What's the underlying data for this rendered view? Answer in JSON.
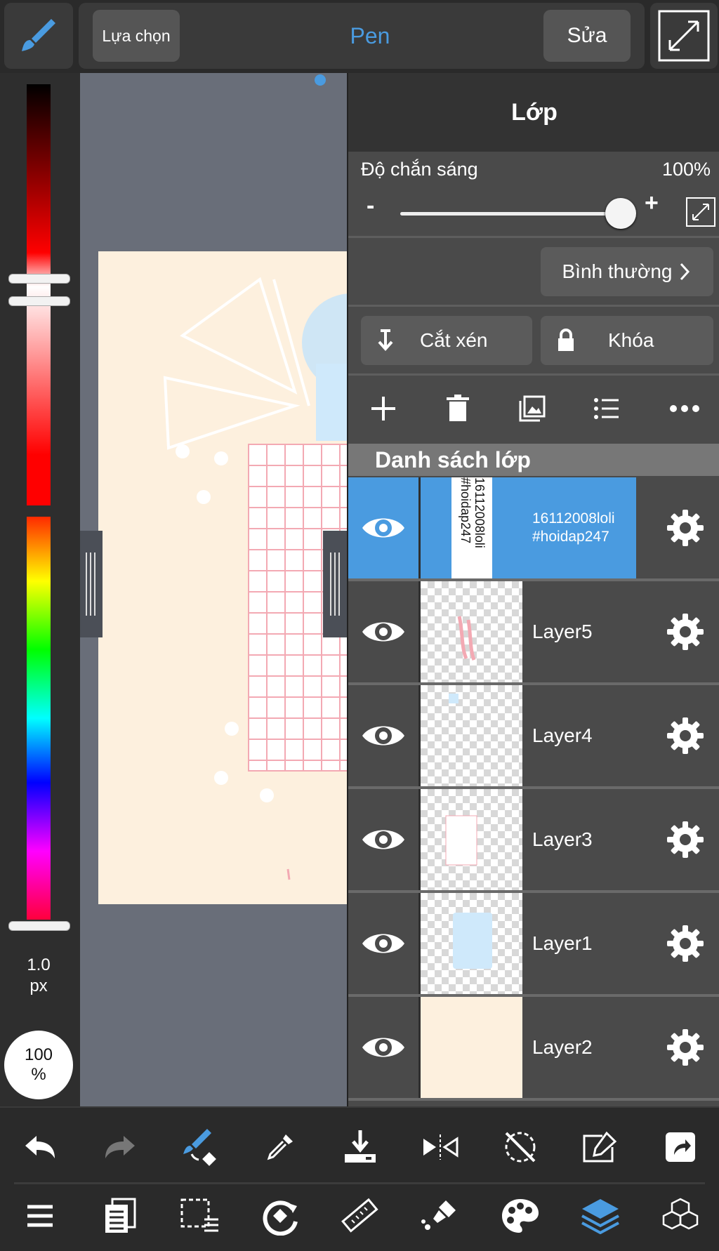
{
  "topbar": {
    "select_label": "Lựa chọn",
    "tool_name": "Pen",
    "edit_label": "Sửa",
    "accent": "#4a9be0"
  },
  "left_panel": {
    "brush_size": "1.0",
    "brush_unit": "px",
    "opacity": "100",
    "opacity_unit": "%"
  },
  "layer_panel": {
    "title": "Lớp",
    "opacity_label": "Độ chắn sáng",
    "opacity_value": "100%",
    "opacity_fraction": 0.95,
    "minus": "-",
    "plus": "+",
    "blend_mode": "Bình thường",
    "clip_label": "Cắt xén",
    "lock_label": "Khóa",
    "list_title": "Danh sách lớp",
    "layers": [
      {
        "name": "16112008loli\n#hoidap247",
        "thumb_text": "16112008loli\n#hoidap247",
        "selected": true
      },
      {
        "name": "Layer5",
        "selected": false
      },
      {
        "name": "Layer4",
        "selected": false
      },
      {
        "name": "Layer3",
        "selected": false
      },
      {
        "name": "Layer1",
        "selected": false
      },
      {
        "name": "Layer2",
        "selected": false
      }
    ]
  },
  "colors": {
    "selected_row": "#4a9be0",
    "canvas_bg": "#fdf0de",
    "grid_pink": "#f3a9b3"
  },
  "bottom_toolbar": {
    "row1": [
      "undo-icon",
      "redo-icon",
      "brush-transform-icon",
      "eyedropper-icon",
      "download-icon",
      "flip-icon",
      "rotate-off-icon",
      "edit-window-icon",
      "share-icon"
    ],
    "row2": [
      "menu-icon",
      "pages-icon",
      "selection-icon",
      "rotate-icon",
      "ruler-icon",
      "fill-icon",
      "palette-icon",
      "layers-icon",
      "3d-icon"
    ]
  }
}
